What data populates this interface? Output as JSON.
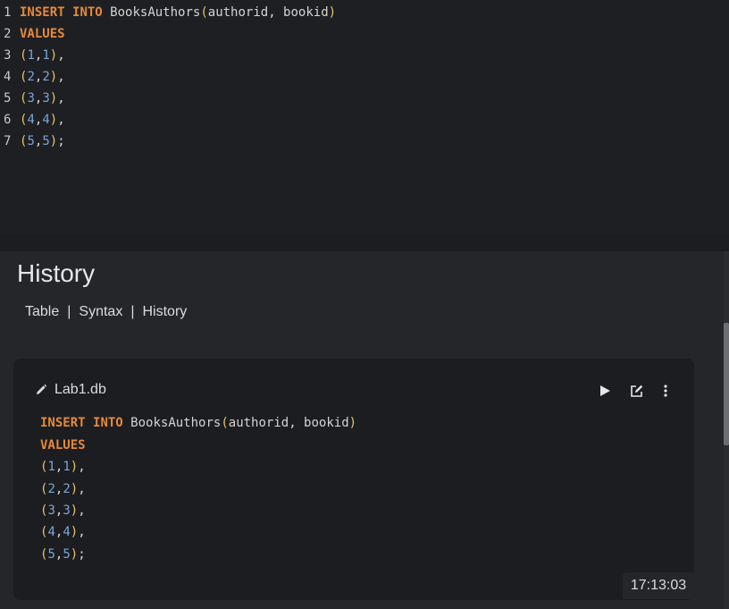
{
  "editor": {
    "lines": [
      {
        "no": "1",
        "kw1": "INSERT",
        "kw2": "INTO",
        "table": "BooksAuthors",
        "cols": "authorid, bookid"
      },
      {
        "no": "2",
        "kw": "VALUES"
      },
      {
        "no": "3",
        "a": "1",
        "b": "1",
        "end": ","
      },
      {
        "no": "4",
        "a": "2",
        "b": "2",
        "end": ","
      },
      {
        "no": "5",
        "a": "3",
        "b": "3",
        "end": ","
      },
      {
        "no": "6",
        "a": "4",
        "b": "4",
        "end": ","
      },
      {
        "no": "7",
        "a": "5",
        "b": "5",
        "end": ";"
      }
    ]
  },
  "history": {
    "title": "History",
    "nav": [
      "Table",
      "Syntax",
      "History"
    ],
    "nav_separator": "|",
    "card": {
      "database": "Lab1.db",
      "actions": [
        "play-icon",
        "edit-icon",
        "more-vertical-icon"
      ],
      "sql": [
        {
          "kw1": "INSERT",
          "kw2": "INTO",
          "table": "BooksAuthors",
          "cols": "authorid, bookid"
        },
        {
          "kw": "VALUES"
        },
        {
          "a": "1",
          "b": "1",
          "end": ","
        },
        {
          "a": "2",
          "b": "2",
          "end": ","
        },
        {
          "a": "3",
          "b": "3",
          "end": ","
        },
        {
          "a": "4",
          "b": "4",
          "end": ","
        },
        {
          "a": "5",
          "b": "5",
          "end": ";"
        }
      ],
      "timestamp": "17:13:03"
    }
  },
  "colors": {
    "keyword": "#e5893b",
    "paren": "#e3c76b",
    "number": "#7aa6d6",
    "text": "#d4d4d4"
  }
}
